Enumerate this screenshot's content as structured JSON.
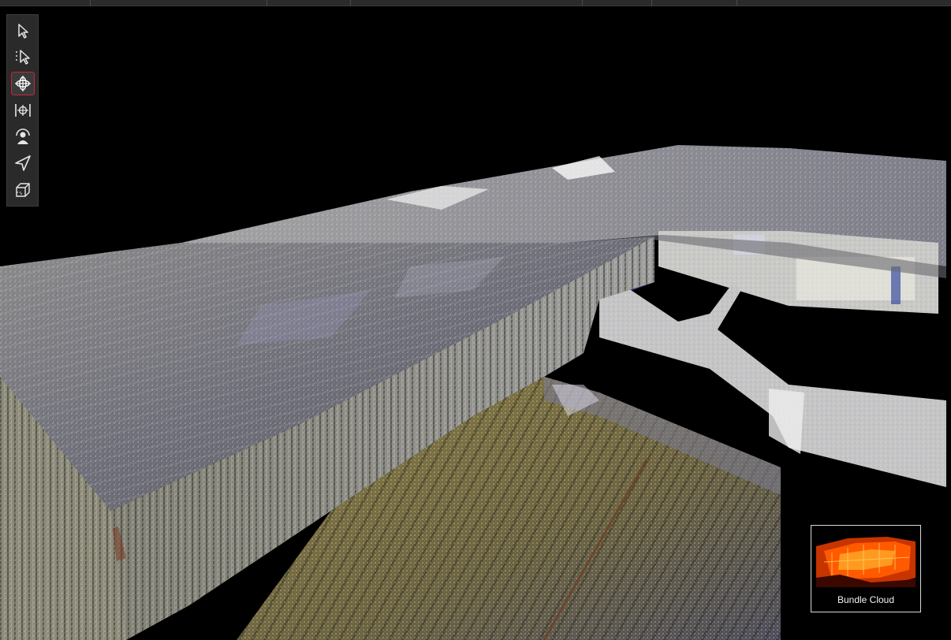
{
  "toolbar": {
    "tools": [
      {
        "id": "select",
        "icon": "arrow-cursor-icon",
        "active": false
      },
      {
        "id": "multi-select",
        "icon": "dotted-arrow-cursor-icon",
        "active": false
      },
      {
        "id": "orbit",
        "icon": "orbit-crosshair-icon",
        "active": true
      },
      {
        "id": "pan",
        "icon": "pan-bracket-icon",
        "active": false
      },
      {
        "id": "walk",
        "icon": "person-view-icon",
        "active": false
      },
      {
        "id": "fly",
        "icon": "paper-plane-icon",
        "active": false
      },
      {
        "id": "box-section",
        "icon": "section-box-icon",
        "active": false
      }
    ]
  },
  "preview": {
    "label": "Bundle Cloud",
    "icon": "bundle-cloud-thumbnail"
  },
  "colors": {
    "toolbar_bg": "#2a2a2a",
    "active_outline": "#c3283e",
    "preview_thumb": "#ff5a00"
  }
}
